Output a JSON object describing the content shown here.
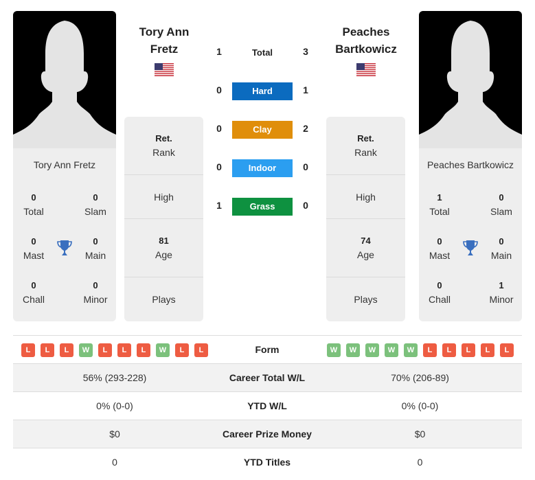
{
  "colors": {
    "hard": "#0b6bbf",
    "clay": "#e08e0b",
    "indoor": "#2b9ef0",
    "grass": "#0e9140",
    "win": "#7cc17c",
    "loss": "#ee5c42",
    "trophy": "#3a6fbf"
  },
  "player1": {
    "name": "Tory Ann Fretz",
    "name_line1": "Tory Ann",
    "name_line2": "Fretz",
    "flag": "us-flag",
    "titles": {
      "total": "0",
      "total_label": "Total",
      "slam": "0",
      "slam_label": "Slam",
      "mast": "0",
      "mast_label": "Mast",
      "main": "0",
      "main_label": "Main",
      "chall": "0",
      "chall_label": "Chall",
      "minor": "0",
      "minor_label": "Minor"
    },
    "rank": {
      "value": "Ret.",
      "label": "Rank"
    },
    "high": {
      "value": "",
      "label": "High"
    },
    "age": {
      "value": "81",
      "label": "Age"
    },
    "plays": {
      "value": "",
      "label": "Plays"
    },
    "form": [
      "L",
      "L",
      "L",
      "W",
      "L",
      "L",
      "L",
      "W",
      "L",
      "L"
    ],
    "career_wl": "56% (293-228)",
    "ytd_wl": "0% (0-0)",
    "prize_money": "$0",
    "ytd_titles": "0"
  },
  "player2": {
    "name": "Peaches Bartkowicz",
    "name_line1": "Peaches",
    "name_line2": "Bartkowicz",
    "flag": "us-flag",
    "titles": {
      "total": "1",
      "total_label": "Total",
      "slam": "0",
      "slam_label": "Slam",
      "mast": "0",
      "mast_label": "Mast",
      "main": "0",
      "main_label": "Main",
      "chall": "0",
      "chall_label": "Chall",
      "minor": "1",
      "minor_label": "Minor"
    },
    "rank": {
      "value": "Ret.",
      "label": "Rank"
    },
    "high": {
      "value": "",
      "label": "High"
    },
    "age": {
      "value": "74",
      "label": "Age"
    },
    "plays": {
      "value": "",
      "label": "Plays"
    },
    "form": [
      "W",
      "W",
      "W",
      "W",
      "W",
      "L",
      "L",
      "L",
      "L",
      "L"
    ],
    "career_wl": "70% (206-89)",
    "ytd_wl": "0% (0-0)",
    "prize_money": "$0",
    "ytd_titles": "0"
  },
  "h2h": {
    "total": {
      "label": "Total",
      "p1": "1",
      "p2": "3"
    },
    "hard": {
      "label": "Hard",
      "p1": "0",
      "p2": "1"
    },
    "clay": {
      "label": "Clay",
      "p1": "0",
      "p2": "2"
    },
    "indoor": {
      "label": "Indoor",
      "p1": "0",
      "p2": "0"
    },
    "grass": {
      "label": "Grass",
      "p1": "1",
      "p2": "0"
    }
  },
  "table": {
    "form_label": "Form",
    "career_label": "Career Total W/L",
    "ytd_label": "YTD W/L",
    "prize_label": "Career Prize Money",
    "titles_label": "YTD Titles"
  }
}
